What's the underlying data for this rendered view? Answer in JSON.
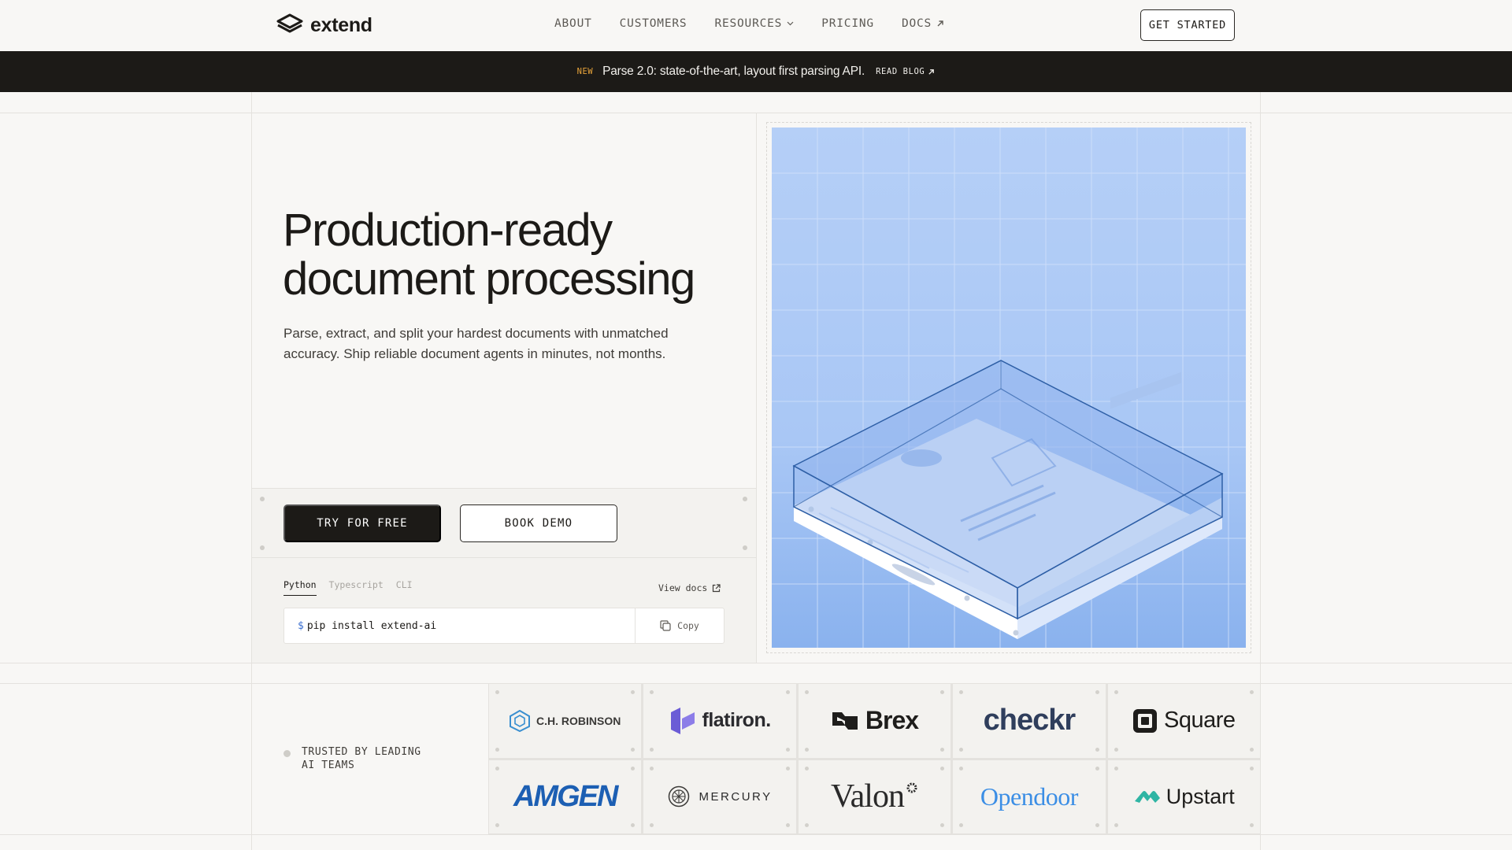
{
  "nav": {
    "brand": "extend",
    "links": [
      {
        "label": "ABOUT"
      },
      {
        "label": "CUSTOMERS"
      },
      {
        "label": "RESOURCES"
      },
      {
        "label": "PRICING"
      },
      {
        "label": "DOCS"
      }
    ],
    "cta": "GET STARTED"
  },
  "banner": {
    "tag": "NEW",
    "text": "Parse 2.0: state-of-the-art, layout first parsing API.",
    "link": "READ BLOG"
  },
  "hero": {
    "title_line1": "Production-ready",
    "title_line2": "document processing",
    "subtitle": "Parse, extract, and split your hardest documents with unmatched accuracy. Ship reliable document agents in minutes, not months.",
    "primary_cta": "TRY FOR FREE",
    "secondary_cta": "BOOK DEMO"
  },
  "install": {
    "tabs": [
      "Python",
      "Typescript",
      "CLI"
    ],
    "active_tab": "Python",
    "view_docs": "View docs",
    "prompt": "$",
    "command": "pip install extend-ai",
    "copy": "Copy"
  },
  "trusted": {
    "label": "TRUSTED BY LEADING AI TEAMS",
    "logos": [
      "C.H. ROBINSON",
      "flatiron.",
      "Brex",
      "checkr",
      "Square",
      "AMGEN",
      "MERCURY",
      "Valon",
      "Opendoor",
      "Upstart"
    ]
  },
  "colors": {
    "ink": "#1c1a17",
    "background": "#f8f7f5",
    "accent_new": "#e8a43a",
    "illustration_blue": "#a9c6f4"
  }
}
